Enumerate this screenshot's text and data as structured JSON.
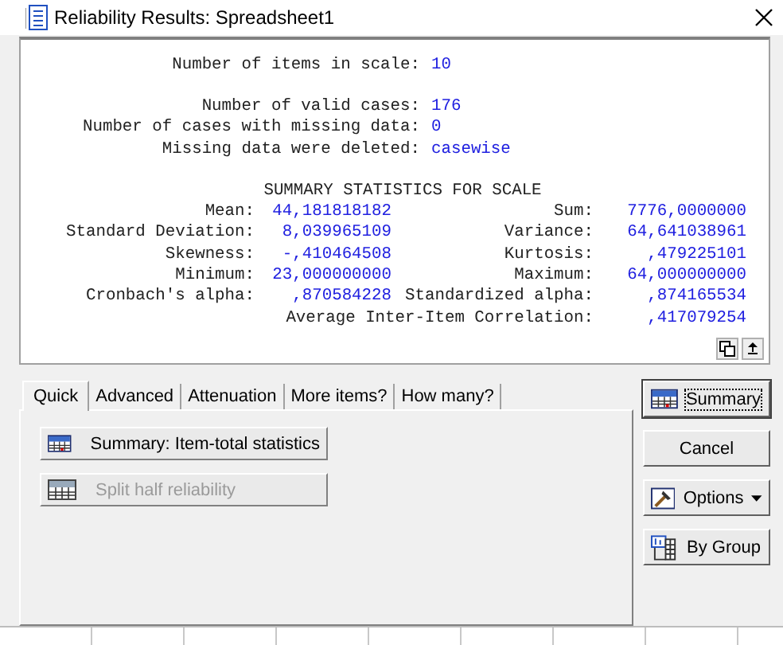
{
  "window": {
    "title": "Reliability Results: Spreadsheet1"
  },
  "output": {
    "info_groups": [
      [
        {
          "label": "Number of items in scale:",
          "value": "10"
        }
      ],
      [
        {
          "label": "Number of valid cases:",
          "value": "176"
        },
        {
          "label": "Number of cases with missing data:",
          "value": "0"
        },
        {
          "label": "Missing data were deleted:",
          "value": "casewise"
        }
      ]
    ],
    "stats_title": "SUMMARY STATISTICS FOR SCALE",
    "stats_rows": [
      {
        "left_label": "Mean:",
        "left_value": "44,181818182",
        "right_label": "Sum:",
        "right_value": "7776,0000000"
      },
      {
        "left_label": "Standard Deviation:",
        "left_value": "8,039965109",
        "right_label": "Variance:",
        "right_value": "64,641038961"
      },
      {
        "left_label": "Skewness:",
        "left_value": "-,410464508",
        "right_label": "Kurtosis:",
        "right_value": ",479225101"
      },
      {
        "left_label": "Minimum:",
        "left_value": "23,000000000",
        "right_label": "Maximum:",
        "right_value": "64,000000000"
      },
      {
        "left_label": "Cronbach's alpha:",
        "left_value": ",870584228",
        "right_label": "Standardized alpha:",
        "right_value": ",874165534"
      },
      {
        "right_label": "Average Inter-Item Correlation:",
        "right_value": ",417079254"
      }
    ]
  },
  "tabs": [
    {
      "label": "Quick",
      "selected": true
    },
    {
      "label": "Advanced",
      "selected": false
    },
    {
      "label": "Attenuation",
      "selected": false
    },
    {
      "label": "More items?",
      "selected": false
    },
    {
      "label": "How many?",
      "selected": false
    }
  ],
  "panel_buttons": [
    {
      "label": "Summary:  Item-total statistics",
      "disabled": false,
      "kind": "table"
    },
    {
      "label": "Split half reliability",
      "disabled": true,
      "kind": "split"
    }
  ],
  "side_buttons": [
    {
      "label": "Summary",
      "kind": "table",
      "caret": false,
      "focused": true
    },
    {
      "label": "Cancel",
      "kind": "plain",
      "caret": false,
      "focused": false
    },
    {
      "label": "Options",
      "kind": "options",
      "caret": true,
      "focused": false
    },
    {
      "label": "By Group",
      "kind": "group",
      "caret": false,
      "focused": false
    }
  ]
}
